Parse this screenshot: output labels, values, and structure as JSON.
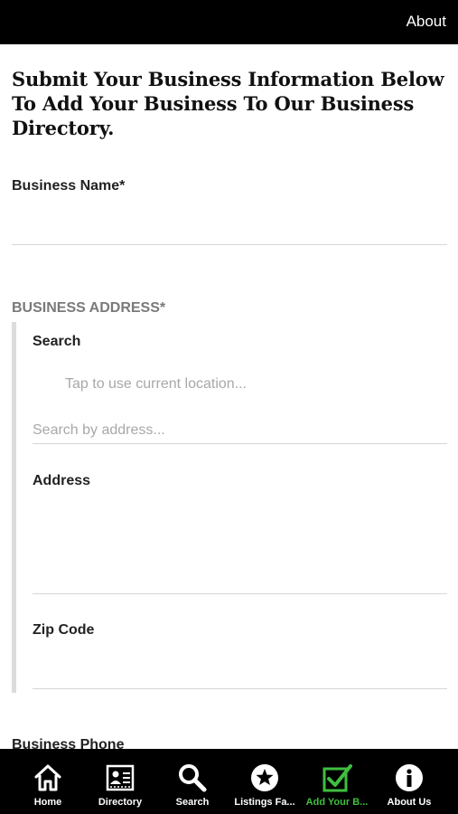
{
  "header": {
    "right_link": "About"
  },
  "form": {
    "headline": "Submit Your Business Information Below To Add Your Business To Our Business Directory.",
    "business_name_label": "Business Name*",
    "address_section_title": "BUSINESS ADDRESS*",
    "search_label": "Search",
    "current_location_placeholder": "Tap to use current location...",
    "search_address_placeholder": "Search by address...",
    "address_label": "Address",
    "zip_label": "Zip Code",
    "phone_label": "Business Phone"
  },
  "tabbar": {
    "active_color": "#3fbf3f",
    "tabs": [
      {
        "label": "Home",
        "icon": "home-icon"
      },
      {
        "label": "Directory",
        "icon": "directory-icon"
      },
      {
        "label": "Search",
        "icon": "search-icon"
      },
      {
        "label": "Listings Fa...",
        "icon": "star-icon"
      },
      {
        "label": "Add Your B...",
        "icon": "checkbox-icon",
        "active": true
      },
      {
        "label": "About Us",
        "icon": "info-icon"
      }
    ]
  }
}
